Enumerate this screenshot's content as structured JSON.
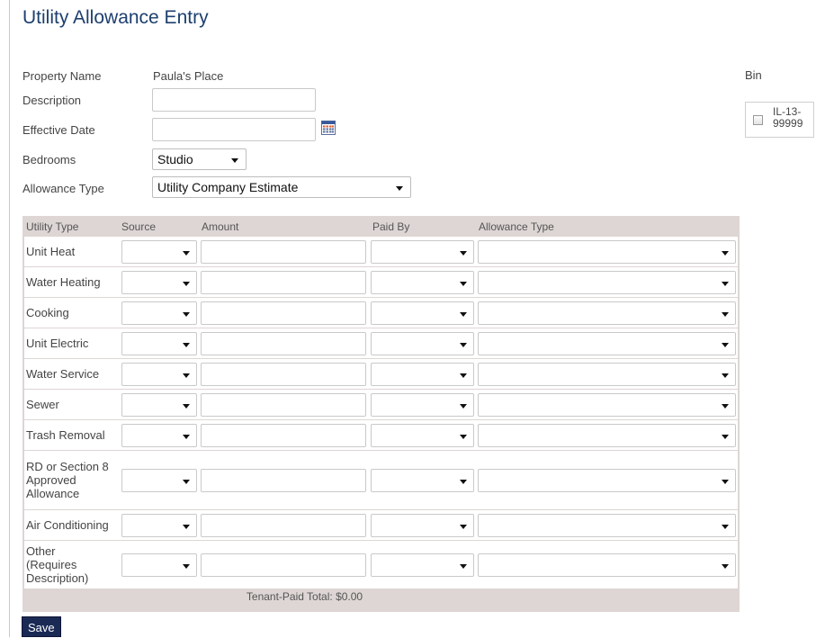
{
  "page": {
    "title": "Utility Allowance Entry"
  },
  "form": {
    "property_name_label": "Property Name",
    "property_name_value": "Paula's Place",
    "description_label": "Description",
    "description_value": "",
    "effective_date_label": "Effective Date",
    "effective_date_value": "",
    "bedrooms_label": "Bedrooms",
    "bedrooms_value": "Studio",
    "allowance_type_label": "Allowance Type",
    "allowance_type_value": "Utility Company Estimate"
  },
  "bin": {
    "label": "Bin",
    "items": [
      {
        "text": "IL-13-\n99999",
        "checked": false
      }
    ]
  },
  "table": {
    "headers": [
      "Utility Type",
      "Source",
      "Amount",
      "Paid By",
      "Allowance Type"
    ],
    "rows": [
      {
        "name": "Unit Heat",
        "source": "",
        "amount": "",
        "paid_by": "",
        "allowance_type": ""
      },
      {
        "name": "Water Heating",
        "source": "",
        "amount": "",
        "paid_by": "",
        "allowance_type": ""
      },
      {
        "name": "Cooking",
        "source": "",
        "amount": "",
        "paid_by": "",
        "allowance_type": ""
      },
      {
        "name": "Unit Electric",
        "source": "",
        "amount": "",
        "paid_by": "",
        "allowance_type": ""
      },
      {
        "name": "Water Service",
        "source": "",
        "amount": "",
        "paid_by": "",
        "allowance_type": ""
      },
      {
        "name": "Sewer",
        "source": "",
        "amount": "",
        "paid_by": "",
        "allowance_type": ""
      },
      {
        "name": "Trash Removal",
        "source": "",
        "amount": "",
        "paid_by": "",
        "allowance_type": ""
      },
      {
        "name": "RD or Section 8\nApproved\nAllowance",
        "source": "",
        "amount": "",
        "paid_by": "",
        "allowance_type": ""
      },
      {
        "name": "Air Conditioning",
        "source": "",
        "amount": "",
        "paid_by": "",
        "allowance_type": ""
      },
      {
        "name": "Other\n(Requires\nDescription)",
        "source": "",
        "amount": "",
        "paid_by": "",
        "allowance_type": ""
      }
    ],
    "total_label": "Tenant-Paid Total: $0.00"
  },
  "actions": {
    "save_label": "Save"
  },
  "icons": {
    "calendar": "calendar-icon",
    "dropdown": "chevron-down-icon"
  },
  "colors": {
    "title": "#1d3f6e",
    "grid_bg": "#ddd6d4",
    "save_bg": "#1a2a55"
  }
}
